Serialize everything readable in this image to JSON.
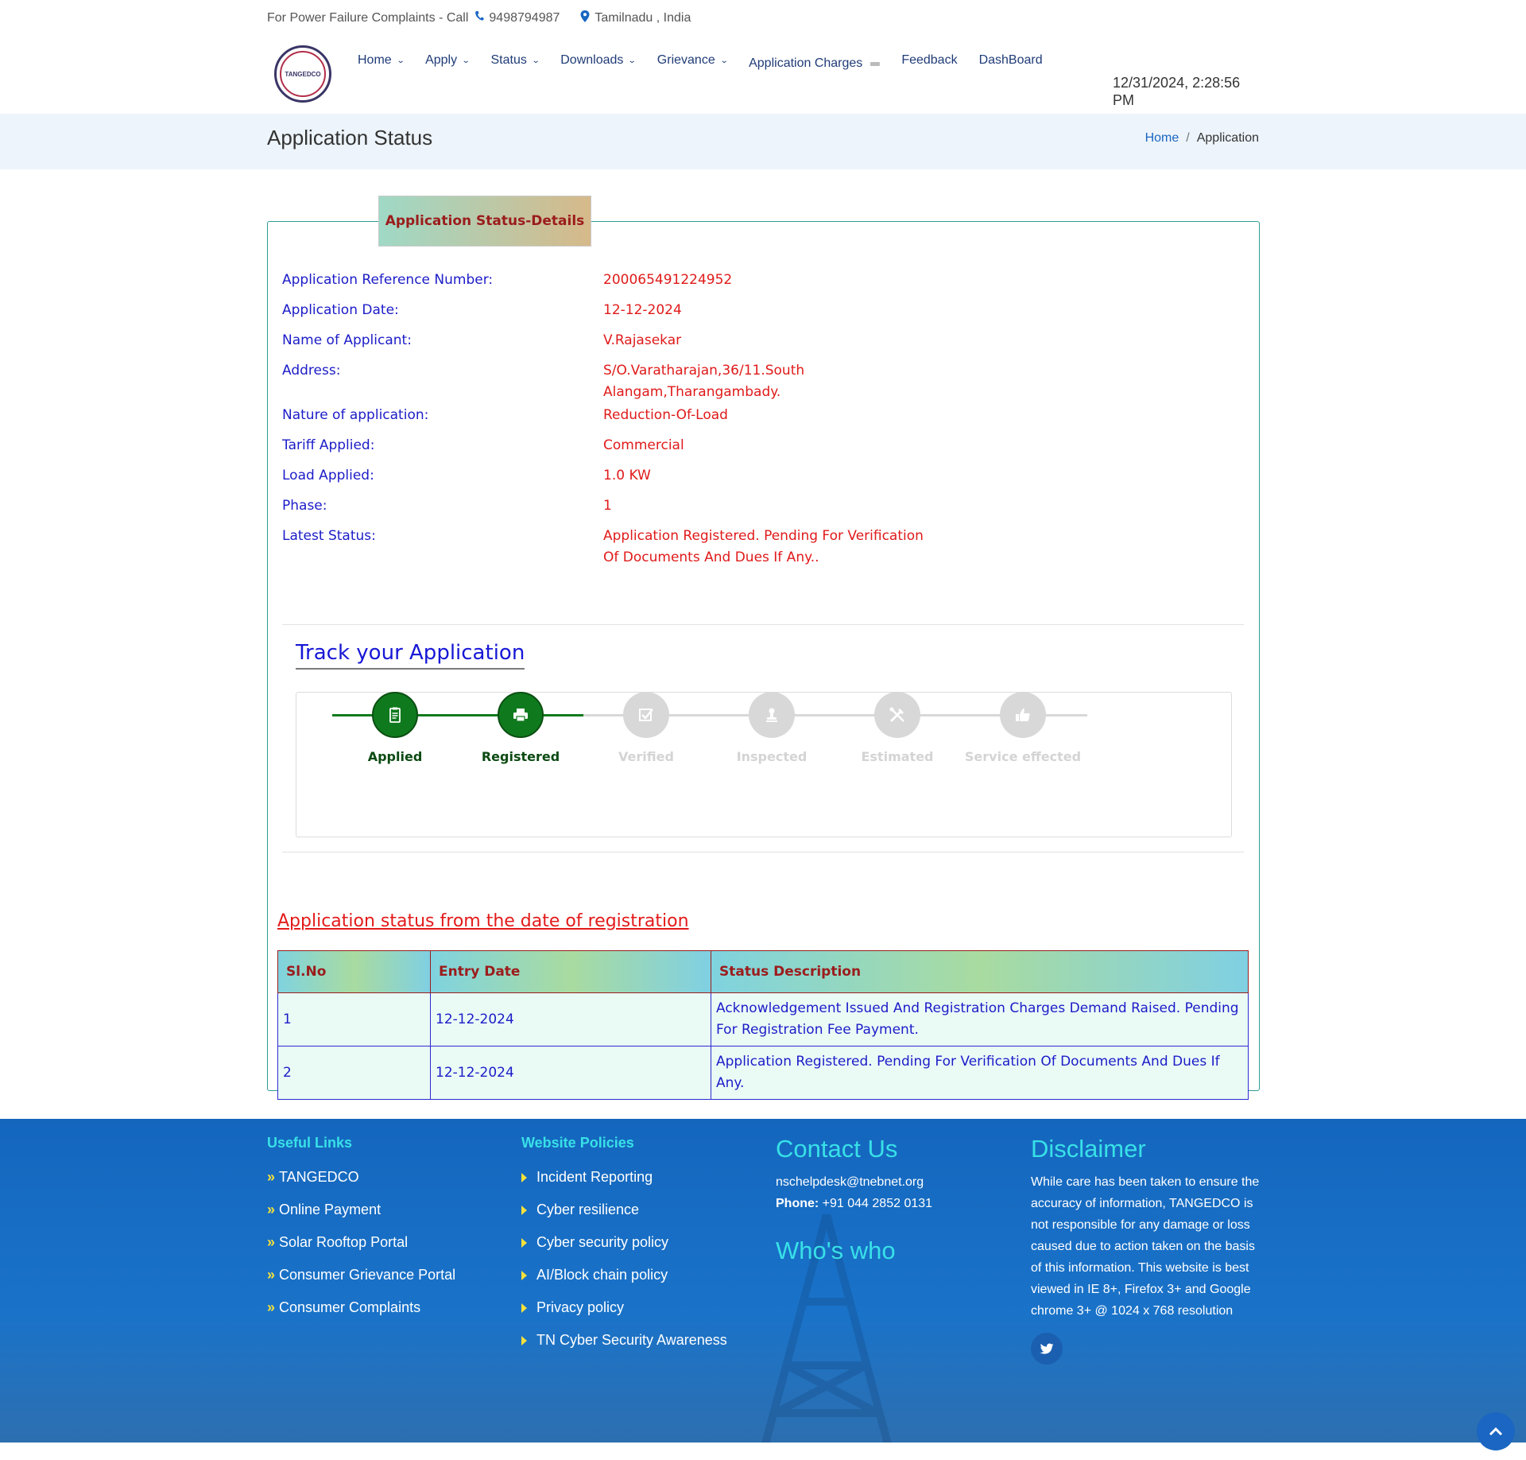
{
  "topbar": {
    "complaint_text": "For Power Failure Complaints - Call",
    "phone": "9498794987",
    "location": "Tamilnadu , India",
    "phone_icon": "phone-icon",
    "location_icon": "map-pin-icon"
  },
  "header": {
    "logo_text": "TANGEDCO",
    "nav": [
      {
        "label": "Home",
        "dropdown": true
      },
      {
        "label": "Apply",
        "dropdown": true
      },
      {
        "label": "Status",
        "dropdown": true
      },
      {
        "label": "Downloads",
        "dropdown": true
      },
      {
        "label": "Grievance",
        "dropdown": true
      },
      {
        "label": "Application Charges",
        "dropdown": false
      },
      {
        "label": "Feedback",
        "dropdown": false
      },
      {
        "label": "DashBoard",
        "dropdown": false
      }
    ],
    "datetime": "12/31/2024, 2:28:56 PM"
  },
  "page": {
    "title": "Application Status",
    "breadcrumb": {
      "home": "Home",
      "current": "Application"
    }
  },
  "details": {
    "tab_label": "Application Status-Details",
    "rows": [
      {
        "label": "Application Reference Number:",
        "value": "200065491224952"
      },
      {
        "label": "Application Date:",
        "value": "12-12-2024"
      },
      {
        "label": "Name of Applicant:",
        "value": "V.Rajasekar"
      },
      {
        "label": "Address:",
        "value": "S/O.Varatharajan,36/11.South Alangam,Tharangambady."
      },
      {
        "label": "Nature of application:",
        "value": "Reduction-Of-Load"
      },
      {
        "label": "Tariff Applied:",
        "value": "Commercial"
      },
      {
        "label": "Load Applied:",
        "value": "1.0 KW"
      },
      {
        "label": "Phase:",
        "value": "1"
      },
      {
        "label": "Latest Status:",
        "value": "Application Registered. Pending For Verification Of Documents And Dues If Any.."
      }
    ]
  },
  "tracker": {
    "title": "Track your Application",
    "steps": [
      {
        "label": "Applied",
        "done": true,
        "icon": "clipboard-icon"
      },
      {
        "label": "Registered",
        "done": true,
        "icon": "printer-icon"
      },
      {
        "label": "Verified",
        "done": false,
        "icon": "checkbox-icon"
      },
      {
        "label": "Inspected",
        "done": false,
        "icon": "stamp-icon"
      },
      {
        "label": "Estimated",
        "done": false,
        "icon": "tools-icon"
      },
      {
        "label": "Service effected",
        "done": false,
        "icon": "thumbs-up-icon"
      }
    ],
    "done_color": "#0f7a1d",
    "pending_color": "#d8d8d8"
  },
  "history": {
    "title": "Application status from the date of registration",
    "columns": [
      "Sl.No",
      "Entry Date",
      "Status Description"
    ],
    "rows": [
      [
        "1",
        "12-12-2024",
        "Acknowledgement Issued And Registration Charges Demand Raised. Pending For Registration Fee Payment."
      ],
      [
        "2",
        "12-12-2024",
        "Application Registered. Pending For Verification Of Documents And Dues If Any."
      ]
    ]
  },
  "footer": {
    "useful_links": {
      "heading": "Useful Links",
      "items": [
        "TANGEDCO",
        "Online Payment",
        "Solar Rooftop Portal",
        "Consumer Grievance Portal",
        "Consumer Complaints"
      ]
    },
    "policies": {
      "heading": "Website Policies",
      "items": [
        "Incident Reporting",
        "Cyber resilience",
        "Cyber security policy",
        "AI/Block chain policy",
        "Privacy policy",
        "TN Cyber Security Awareness"
      ]
    },
    "contact": {
      "heading": "Contact Us",
      "email": "nschelpdesk@tnebnet.org",
      "phone_label": "Phone:",
      "phone": "+91 044 2852 0131",
      "whos_who": "Who's who"
    },
    "disclaimer": {
      "heading": "Disclaimer",
      "text": "While care has been taken to ensure the accuracy of information, TANGEDCO is not responsible for any damage or loss caused due to action taken on the basis of this information. This website is best viewed in IE 8+, Firefox 3+ and Google chrome 3+ @ 1024 x 768 resolution"
    },
    "social_icon": "twitter-icon",
    "scroll_icon": "chevron-up-icon"
  }
}
